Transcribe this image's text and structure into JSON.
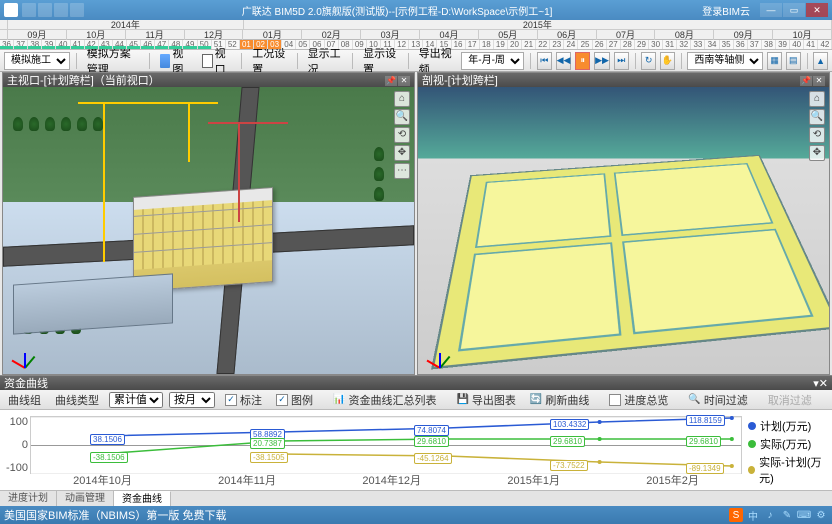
{
  "app": {
    "title": "广联达 BIM5D 2.0旗舰版(测试版)--[示例工程-D:\\WorkSpace\\示例工~1]",
    "cloud_login": "登录BIM云"
  },
  "timeline": {
    "year_2014": "2014年",
    "year_2015": "2015年",
    "months": [
      "09月",
      "10月",
      "11月",
      "12月",
      "01月",
      "02月",
      "03月",
      "04月",
      "05月",
      "06月",
      "07月",
      "08月",
      "09月",
      "10月"
    ],
    "weeks": [
      "36",
      "37",
      "38",
      "39",
      "40",
      "41",
      "42",
      "43",
      "44",
      "45",
      "46",
      "47",
      "48",
      "49",
      "50",
      "51",
      "52",
      "01",
      "02",
      "03",
      "04",
      "05",
      "06",
      "07",
      "08",
      "09",
      "10",
      "11",
      "12",
      "13",
      "14",
      "15",
      "16",
      "17",
      "18",
      "19",
      "20",
      "21",
      "22",
      "23",
      "24",
      "25",
      "26",
      "27",
      "28",
      "29",
      "30",
      "31",
      "32",
      "33",
      "34",
      "35",
      "36",
      "37",
      "38",
      "39",
      "40",
      "41",
      "42"
    ]
  },
  "toolbar": {
    "mode": "模拟施工",
    "scheme": "模拟方案管理",
    "view_btn": "视图",
    "viewport_btn": "视口",
    "worker_setting": "工况设置",
    "display_project": "显示工况",
    "display_setting": "显示设置",
    "export_video": "导出视频",
    "time_format": "年-月-周",
    "camera_lock": "西南等轴侧"
  },
  "viewports": {
    "left_title": "主视口-[计划跨栏]（当前视口）",
    "right_title": "剖视-[计划跨栏]"
  },
  "curve_panel": {
    "title": "资金曲线",
    "toolbar": {
      "curve_group": "曲线组",
      "curve_type": "曲线类型",
      "accumulate": "累计值",
      "by_month": "按月",
      "annotate": "标注",
      "legend": "图例",
      "summary_table": "资金曲线汇总列表",
      "export_chart": "导出图表",
      "refresh": "刷新曲线",
      "overview": "进度总览",
      "time_filter": "时间过滤",
      "cancel_filter": "取消过滤"
    },
    "legend": {
      "plan": "计划(万元)",
      "actual": "实际(万元)",
      "diff": "实际-计划(万元)"
    },
    "y_ticks": [
      "100",
      "0",
      "-100"
    ],
    "x_ticks": [
      "2014年10月",
      "2014年11月",
      "2014年12月",
      "2015年1月",
      "2015年2月"
    ]
  },
  "chart_data": {
    "type": "line",
    "categories": [
      "2014年10月",
      "2014年11月",
      "2014年12月",
      "2015年1月",
      "2015年2月"
    ],
    "series": [
      {
        "name": "计划(万元)",
        "color": "#2a5ad4",
        "values": [
          38.1506,
          58.8892,
          74.8074,
          103.4332,
          118.8159
        ]
      },
      {
        "name": "实际(万元)",
        "color": "#3bbd3b",
        "values": [
          -38.1506,
          20.7387,
          29.681,
          29.681,
          29.681
        ]
      },
      {
        "name": "实际-计划(万元)",
        "color": "#c9b23a",
        "values": [
          null,
          -38.1505,
          -45.1264,
          -73.7522,
          -89.1349
        ]
      }
    ],
    "ylim": [
      -100,
      150
    ],
    "title": "",
    "xlabel": "",
    "ylabel": ""
  },
  "bottom_tabs": {
    "t1": "进度计划",
    "t2": "动画管理",
    "t3": "资金曲线"
  },
  "statusbar": {
    "left_text": "美国国家BIM标准（NBIMS）第一版 免费下载"
  }
}
